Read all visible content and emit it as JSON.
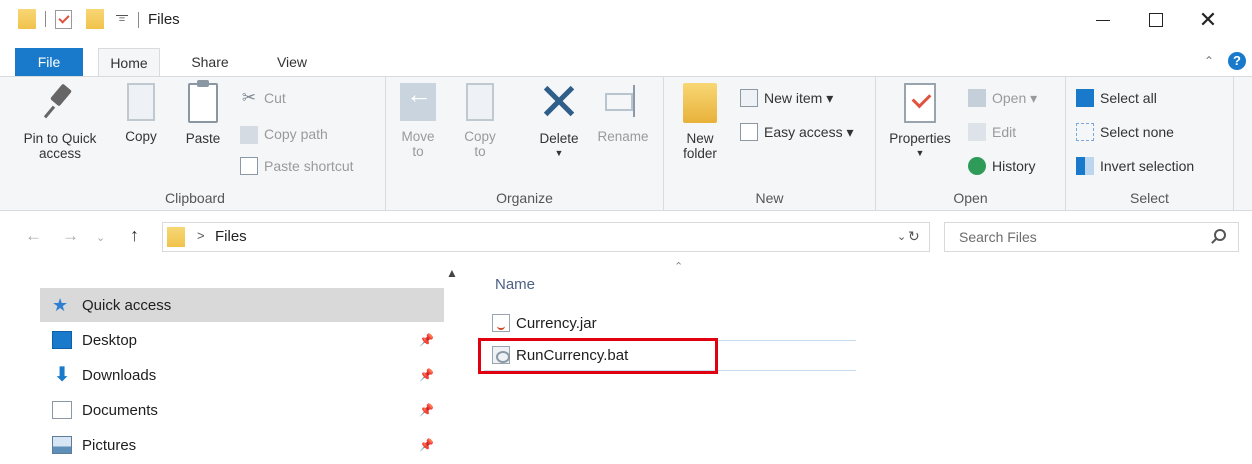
{
  "window": {
    "title": "Files",
    "qat_dropdown": "=",
    "close_glyph": "✕"
  },
  "tabs": {
    "file": "File",
    "home": "Home",
    "share": "Share",
    "view": "View",
    "help": "?"
  },
  "ribbon": {
    "clipboard": {
      "label": "Clipboard",
      "pin": "Pin to Quick access",
      "copy": "Copy",
      "paste": "Paste",
      "cut": "Cut",
      "copy_path": "Copy path",
      "paste_shortcut": "Paste shortcut"
    },
    "organize": {
      "label": "Organize",
      "move_to": "Move to",
      "copy_to": "Copy to",
      "delete": "Delete",
      "rename": "Rename"
    },
    "new": {
      "label": "New",
      "new_folder": "New folder",
      "new_item": "New item ▾",
      "easy_access": "Easy access ▾"
    },
    "open": {
      "label": "Open",
      "properties": "Properties",
      "open": "Open ▾",
      "edit": "Edit",
      "history": "History"
    },
    "select": {
      "label": "Select",
      "select_all": "Select all",
      "select_none": "Select none",
      "invert_selection": "Invert selection"
    }
  },
  "address": {
    "path": "Files",
    "separator": ">",
    "search_placeholder": "Search Files"
  },
  "nav": {
    "items": [
      {
        "label": "Quick access",
        "icon": "star-icon"
      },
      {
        "label": "Desktop",
        "icon": "desktop-icon"
      },
      {
        "label": "Downloads",
        "icon": "download-icon"
      },
      {
        "label": "Documents",
        "icon": "documents-icon"
      },
      {
        "label": "Pictures",
        "icon": "pictures-icon"
      }
    ]
  },
  "files": {
    "column_name": "Name",
    "items": [
      {
        "name": "Currency.jar",
        "icon": "jar-file-icon"
      },
      {
        "name": "RunCurrency.bat",
        "icon": "bat-file-icon"
      }
    ]
  },
  "colors": {
    "accent": "#1979ca",
    "highlight": "#e0000f",
    "ribbon_bg": "#f5f6f7",
    "folder": "#f0c24b"
  }
}
